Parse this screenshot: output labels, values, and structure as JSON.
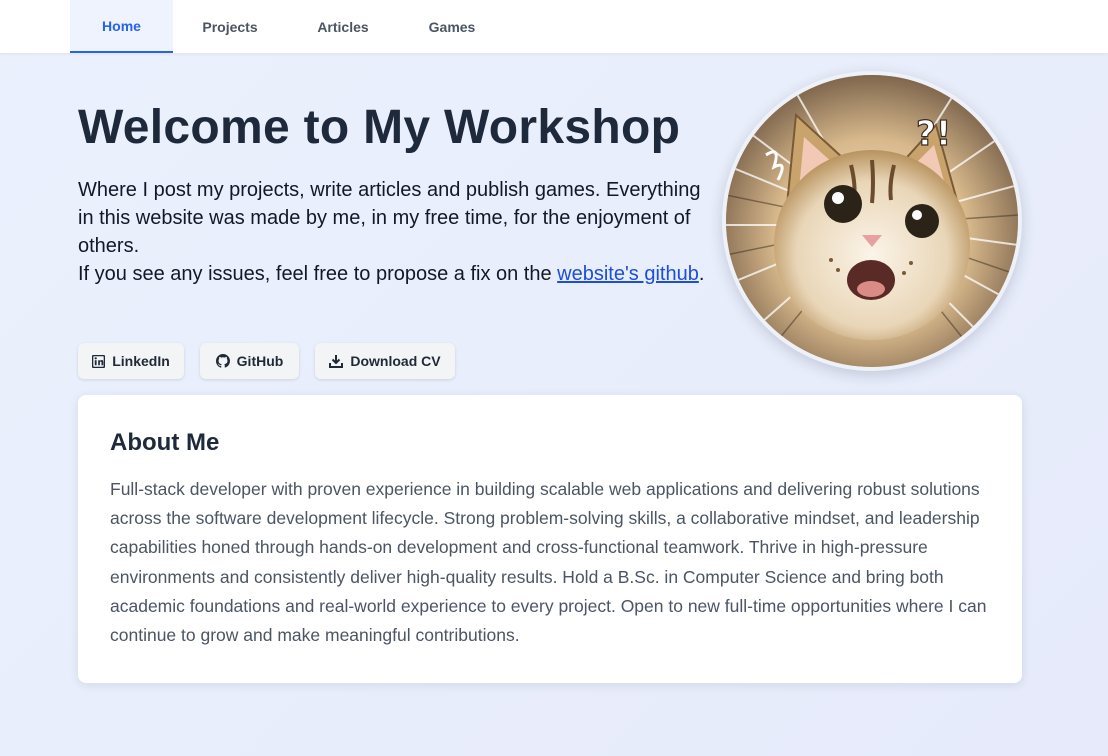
{
  "nav": {
    "tabs": [
      {
        "label": "Home",
        "active": true
      },
      {
        "label": "Projects",
        "active": false
      },
      {
        "label": "Articles",
        "active": false
      },
      {
        "label": "Games",
        "active": false
      }
    ]
  },
  "hero": {
    "title": "Welcome to My Workshop",
    "description_line1": "Where I post my projects, write articles and publish games. Everything in this website was made by me, in my free time, for the enjoyment of others.",
    "description_line2_prefix": "If you see any issues, feel free to propose a fix on the ",
    "github_link_text": "website's github",
    "description_line2_suffix": ".",
    "avatar_overlay_text": "?!"
  },
  "buttons": {
    "linkedin": {
      "label": "LinkedIn",
      "icon": "linkedin-icon"
    },
    "github": {
      "label": "GitHub",
      "icon": "github-icon"
    },
    "cv": {
      "label": "Download CV",
      "icon": "download-icon"
    }
  },
  "about": {
    "title": "About Me",
    "text": "Full-stack developer with proven experience in building scalable web applications and delivering robust solutions across the software development lifecycle. Strong problem-solving skills, a collaborative mindset, and leadership capabilities honed through hands-on development and cross-functional teamwork. Thrive in high-pressure environments and consistently deliver high-quality results. Hold a B.Sc. in Computer Science and bring both academic foundations and real-world experience to every project. Open to new full-time opportunities where I can continue to grow and make meaningful contributions."
  },
  "colors": {
    "accent": "#2563eb",
    "link": "#1d4ed8",
    "heading": "#1e293b",
    "body_text": "#4b5563",
    "background": "#e9eefb"
  }
}
